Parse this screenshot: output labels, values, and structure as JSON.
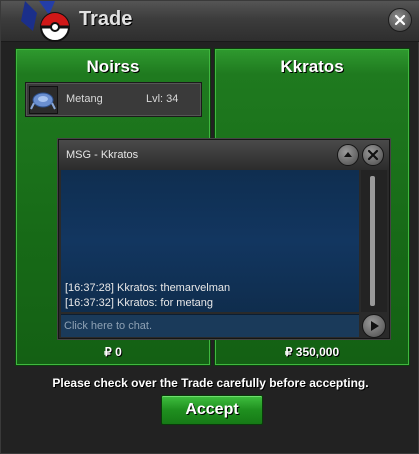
{
  "window": {
    "title": "Trade"
  },
  "panels": {
    "left": {
      "player_name": "Noirss",
      "pokemon": {
        "name": "Metang",
        "level_label": "Lvl: 34",
        "icon": "metang-icon"
      },
      "money": "₽ 0"
    },
    "right": {
      "player_name": "Kkratos",
      "money": "₽ 350,000"
    }
  },
  "chat": {
    "title": "MSG - Kkratos",
    "messages": [
      "[16:37:28] Kkratos: themarvelman",
      "[16:37:32] Kkratos: for metang"
    ],
    "input_placeholder": "Click here to chat."
  },
  "footer": {
    "notice": "Please check over the Trade carefully before accepting.",
    "accept_label": "Accept"
  },
  "colors": {
    "panel_green": "#1f7a1f",
    "chat_blue": "#123660",
    "accept_green": "#2a9a2a"
  }
}
